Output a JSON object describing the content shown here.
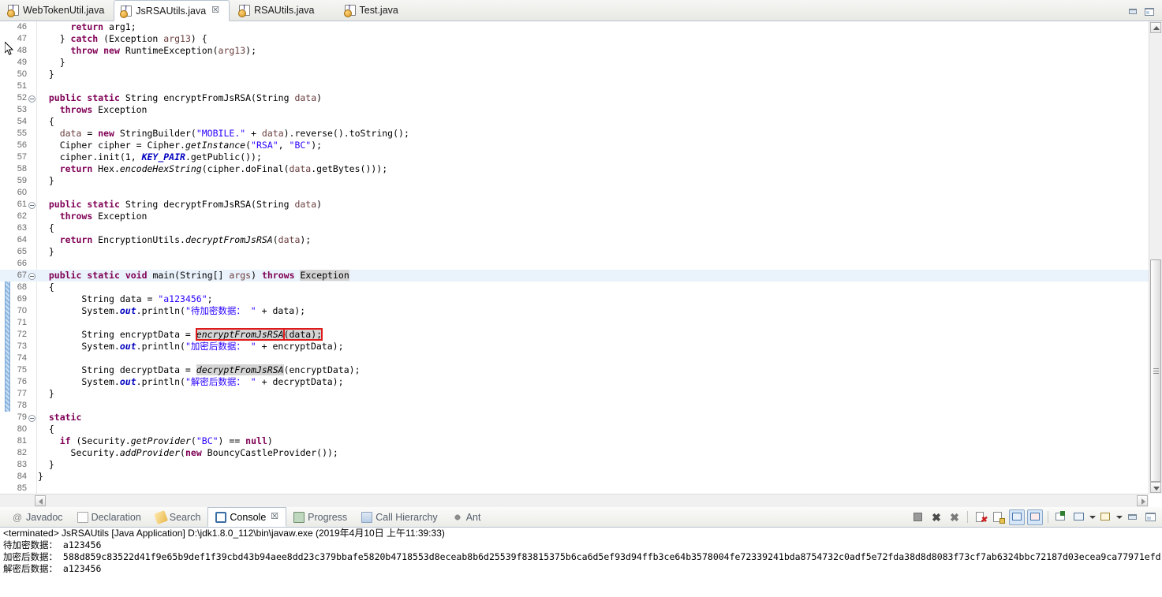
{
  "window": {
    "minimize_label": "Minimize",
    "maximize_label": "Maximize"
  },
  "editor_tabs": [
    {
      "label": "WebTokenUtil.java",
      "active": false,
      "closable": false
    },
    {
      "label": "JsRSAUtils.java",
      "active": true,
      "closable": true,
      "close_glyph": "☒"
    },
    {
      "label": "RSAUtils.java",
      "active": false,
      "closable": false
    },
    {
      "label": "Test.java",
      "active": false,
      "closable": false
    }
  ],
  "code": {
    "first_visible_line": 46,
    "highlighted_line": 67,
    "lines": [
      {
        "n": 46,
        "fold": false,
        "segments": [
          {
            "t": "      ",
            "c": ""
          },
          {
            "t": "return",
            "c": "kw"
          },
          {
            "t": " arg1;",
            "c": ""
          }
        ]
      },
      {
        "n": 47,
        "fold": false,
        "segments": [
          {
            "t": "    } ",
            "c": ""
          },
          {
            "t": "catch",
            "c": "kw"
          },
          {
            "t": " (Exception ",
            "c": ""
          },
          {
            "t": "arg13",
            "c": "par"
          },
          {
            "t": ") {",
            "c": ""
          }
        ]
      },
      {
        "n": 48,
        "fold": false,
        "segments": [
          {
            "t": "      ",
            "c": ""
          },
          {
            "t": "throw",
            "c": "kw"
          },
          {
            "t": " ",
            "c": ""
          },
          {
            "t": "new",
            "c": "kw"
          },
          {
            "t": " RuntimeException(",
            "c": ""
          },
          {
            "t": "arg13",
            "c": "par"
          },
          {
            "t": ");",
            "c": ""
          }
        ]
      },
      {
        "n": 49,
        "fold": false,
        "segments": [
          {
            "t": "    }",
            "c": ""
          }
        ]
      },
      {
        "n": 50,
        "fold": false,
        "segments": [
          {
            "t": "  }",
            "c": ""
          }
        ]
      },
      {
        "n": 51,
        "fold": false,
        "segments": [
          {
            "t": "",
            "c": ""
          }
        ]
      },
      {
        "n": 52,
        "fold": true,
        "segments": [
          {
            "t": "  ",
            "c": ""
          },
          {
            "t": "public",
            "c": "kw"
          },
          {
            "t": " ",
            "c": ""
          },
          {
            "t": "static",
            "c": "kw"
          },
          {
            "t": " String encryptFromJsRSA(String ",
            "c": ""
          },
          {
            "t": "data",
            "c": "par"
          },
          {
            "t": ")",
            "c": ""
          }
        ]
      },
      {
        "n": 53,
        "fold": false,
        "segments": [
          {
            "t": "    ",
            "c": ""
          },
          {
            "t": "throws",
            "c": "kw"
          },
          {
            "t": " Exception",
            "c": ""
          }
        ]
      },
      {
        "n": 54,
        "fold": false,
        "segments": [
          {
            "t": "  {",
            "c": ""
          }
        ]
      },
      {
        "n": 55,
        "fold": false,
        "segments": [
          {
            "t": "    ",
            "c": ""
          },
          {
            "t": "data",
            "c": "par"
          },
          {
            "t": " = ",
            "c": ""
          },
          {
            "t": "new",
            "c": "kw"
          },
          {
            "t": " StringBuilder(",
            "c": ""
          },
          {
            "t": "\"MOBILE.\"",
            "c": "str"
          },
          {
            "t": " + ",
            "c": ""
          },
          {
            "t": "data",
            "c": "par"
          },
          {
            "t": ").reverse().toString();",
            "c": ""
          }
        ]
      },
      {
        "n": 56,
        "fold": false,
        "segments": [
          {
            "t": "    Cipher cipher = Cipher.",
            "c": ""
          },
          {
            "t": "getInstance",
            "c": "mth"
          },
          {
            "t": "(",
            "c": ""
          },
          {
            "t": "\"RSA\"",
            "c": "str"
          },
          {
            "t": ", ",
            "c": ""
          },
          {
            "t": "\"BC\"",
            "c": "str"
          },
          {
            "t": ");",
            "c": ""
          }
        ]
      },
      {
        "n": 57,
        "fold": false,
        "segments": [
          {
            "t": "    cipher.init(1, ",
            "c": ""
          },
          {
            "t": "KEY_PAIR",
            "c": "fld"
          },
          {
            "t": ".getPublic());",
            "c": ""
          }
        ]
      },
      {
        "n": 58,
        "fold": false,
        "segments": [
          {
            "t": "    ",
            "c": ""
          },
          {
            "t": "return",
            "c": "kw"
          },
          {
            "t": " Hex.",
            "c": ""
          },
          {
            "t": "encodeHexString",
            "c": "mth"
          },
          {
            "t": "(cipher.doFinal(",
            "c": ""
          },
          {
            "t": "data",
            "c": "par"
          },
          {
            "t": ".getBytes()));",
            "c": ""
          }
        ]
      },
      {
        "n": 59,
        "fold": false,
        "segments": [
          {
            "t": "  }",
            "c": ""
          }
        ]
      },
      {
        "n": 60,
        "fold": false,
        "segments": [
          {
            "t": "",
            "c": ""
          }
        ]
      },
      {
        "n": 61,
        "fold": true,
        "segments": [
          {
            "t": "  ",
            "c": ""
          },
          {
            "t": "public",
            "c": "kw"
          },
          {
            "t": " ",
            "c": ""
          },
          {
            "t": "static",
            "c": "kw"
          },
          {
            "t": " String decryptFromJsRSA(String ",
            "c": ""
          },
          {
            "t": "data",
            "c": "par"
          },
          {
            "t": ")",
            "c": ""
          }
        ]
      },
      {
        "n": 62,
        "fold": false,
        "segments": [
          {
            "t": "    ",
            "c": ""
          },
          {
            "t": "throws",
            "c": "kw"
          },
          {
            "t": " Exception",
            "c": ""
          }
        ]
      },
      {
        "n": 63,
        "fold": false,
        "segments": [
          {
            "t": "  {",
            "c": ""
          }
        ]
      },
      {
        "n": 64,
        "fold": false,
        "segments": [
          {
            "t": "    ",
            "c": ""
          },
          {
            "t": "return",
            "c": "kw"
          },
          {
            "t": " EncryptionUtils.",
            "c": ""
          },
          {
            "t": "decryptFromJsRSA",
            "c": "mth"
          },
          {
            "t": "(",
            "c": ""
          },
          {
            "t": "data",
            "c": "par"
          },
          {
            "t": ");",
            "c": ""
          }
        ]
      },
      {
        "n": 65,
        "fold": false,
        "segments": [
          {
            "t": "  }",
            "c": ""
          }
        ]
      },
      {
        "n": 66,
        "fold": false,
        "segments": [
          {
            "t": "",
            "c": ""
          }
        ]
      },
      {
        "n": 67,
        "fold": true,
        "segments": [
          {
            "t": "  ",
            "c": ""
          },
          {
            "t": "public",
            "c": "kw"
          },
          {
            "t": " ",
            "c": ""
          },
          {
            "t": "static",
            "c": "kw"
          },
          {
            "t": " ",
            "c": ""
          },
          {
            "t": "void",
            "c": "kw"
          },
          {
            "t": " main(String[] ",
            "c": ""
          },
          {
            "t": "args",
            "c": "par"
          },
          {
            "t": ") ",
            "c": ""
          },
          {
            "t": "throws",
            "c": "kw"
          },
          {
            "t": " ",
            "c": ""
          },
          {
            "t": "Exception",
            "c": "occ"
          }
        ]
      },
      {
        "n": 68,
        "fold": false,
        "segments": [
          {
            "t": "  {",
            "c": ""
          }
        ]
      },
      {
        "n": 69,
        "fold": false,
        "segments": [
          {
            "t": "        String data = ",
            "c": ""
          },
          {
            "t": "\"a123456\"",
            "c": "str"
          },
          {
            "t": ";",
            "c": ""
          }
        ]
      },
      {
        "n": 70,
        "fold": false,
        "segments": [
          {
            "t": "        System.",
            "c": ""
          },
          {
            "t": "out",
            "c": "fld"
          },
          {
            "t": ".println(",
            "c": ""
          },
          {
            "t": "\"待加密数据： \"",
            "c": "str"
          },
          {
            "t": " + data);",
            "c": ""
          }
        ]
      },
      {
        "n": 71,
        "fold": false,
        "segments": [
          {
            "t": "",
            "c": ""
          }
        ]
      },
      {
        "n": 72,
        "fold": false,
        "segments": [
          {
            "t": "        String encryptData = ",
            "c": ""
          },
          {
            "t": "encryptFromJsRSA",
            "c": "boxedmth"
          },
          {
            "t": "(data);",
            "c": "boxedplain"
          }
        ]
      },
      {
        "n": 73,
        "fold": false,
        "segments": [
          {
            "t": "        System.",
            "c": ""
          },
          {
            "t": "out",
            "c": "fld"
          },
          {
            "t": ".println(",
            "c": ""
          },
          {
            "t": "\"加密后数据： \"",
            "c": "str"
          },
          {
            "t": " + encryptData);",
            "c": ""
          }
        ]
      },
      {
        "n": 74,
        "fold": false,
        "segments": [
          {
            "t": "",
            "c": ""
          }
        ]
      },
      {
        "n": 75,
        "fold": false,
        "segments": [
          {
            "t": "        String decryptData = ",
            "c": ""
          },
          {
            "t": "decryptFromJsRSA",
            "c": "occmth"
          },
          {
            "t": "(encryptData);",
            "c": ""
          }
        ]
      },
      {
        "n": 76,
        "fold": false,
        "segments": [
          {
            "t": "        System.",
            "c": ""
          },
          {
            "t": "out",
            "c": "fld"
          },
          {
            "t": ".println(",
            "c": ""
          },
          {
            "t": "\"解密后数据： \"",
            "c": "str"
          },
          {
            "t": " + decryptData);",
            "c": ""
          }
        ]
      },
      {
        "n": 77,
        "fold": false,
        "segments": [
          {
            "t": "  }",
            "c": ""
          }
        ]
      },
      {
        "n": 78,
        "fold": false,
        "segments": [
          {
            "t": "",
            "c": ""
          }
        ]
      },
      {
        "n": 79,
        "fold": true,
        "segments": [
          {
            "t": "  ",
            "c": ""
          },
          {
            "t": "static",
            "c": "kw"
          }
        ]
      },
      {
        "n": 80,
        "fold": false,
        "segments": [
          {
            "t": "  {",
            "c": ""
          }
        ]
      },
      {
        "n": 81,
        "fold": false,
        "segments": [
          {
            "t": "    ",
            "c": ""
          },
          {
            "t": "if",
            "c": "kw"
          },
          {
            "t": " (Security.",
            "c": ""
          },
          {
            "t": "getProvider",
            "c": "mth"
          },
          {
            "t": "(",
            "c": ""
          },
          {
            "t": "\"BC\"",
            "c": "str"
          },
          {
            "t": ") == ",
            "c": ""
          },
          {
            "t": "null",
            "c": "kw"
          },
          {
            "t": ")",
            "c": ""
          }
        ]
      },
      {
        "n": 82,
        "fold": false,
        "segments": [
          {
            "t": "      Security.",
            "c": ""
          },
          {
            "t": "addProvider",
            "c": "mth"
          },
          {
            "t": "(",
            "c": ""
          },
          {
            "t": "new",
            "c": "kw"
          },
          {
            "t": " BouncyCastleProvider());",
            "c": ""
          }
        ]
      },
      {
        "n": 83,
        "fold": false,
        "segments": [
          {
            "t": "  }",
            "c": ""
          }
        ]
      },
      {
        "n": 84,
        "fold": false,
        "segments": [
          {
            "t": "}",
            "c": ""
          }
        ]
      },
      {
        "n": 85,
        "fold": false,
        "segments": [
          {
            "t": "",
            "c": ""
          }
        ]
      }
    ]
  },
  "view_tabs": [
    {
      "label": "Javadoc",
      "icon": "javadoc-icon",
      "active": false
    },
    {
      "label": "Declaration",
      "icon": "declaration-icon",
      "active": false
    },
    {
      "label": "Search",
      "icon": "search-icon",
      "active": false
    },
    {
      "label": "Console",
      "icon": "console-icon",
      "active": true,
      "close_glyph": "☒"
    },
    {
      "label": "Progress",
      "icon": "progress-icon",
      "active": false
    },
    {
      "label": "Call Hierarchy",
      "icon": "call-hierarchy-icon",
      "active": false
    },
    {
      "label": "Ant",
      "icon": "ant-icon",
      "active": false
    }
  ],
  "console_toolbar": [
    {
      "name": "terminate-button",
      "pressed": false
    },
    {
      "name": "remove-launch-button",
      "pressed": false
    },
    {
      "name": "remove-all-terminated-button",
      "pressed": false
    },
    {
      "name": "separator",
      "pressed": false
    },
    {
      "name": "clear-console-button",
      "pressed": false
    },
    {
      "name": "scroll-lock-button",
      "pressed": false
    },
    {
      "name": "show-console-on-output-button",
      "pressed": true
    },
    {
      "name": "show-console-on-error-button",
      "pressed": true
    },
    {
      "name": "separator",
      "pressed": false
    },
    {
      "name": "pin-console-button",
      "pressed": false
    },
    {
      "name": "display-selected-console-button",
      "pressed": false
    },
    {
      "name": "display-selected-console-dropdown",
      "pressed": false
    },
    {
      "name": "open-console-button",
      "pressed": false
    },
    {
      "name": "open-console-dropdown",
      "pressed": false
    },
    {
      "name": "minimize-view-button",
      "pressed": false
    },
    {
      "name": "maximize-view-button",
      "pressed": false
    }
  ],
  "console": {
    "header": "<terminated> JsRSAUtils [Java Application] D:\\jdk1.8.0_112\\bin\\javaw.exe (2019年4月10日 上午11:39:33)",
    "lines": [
      "待加密数据： a123456",
      "加密后数据： 588d859c83522d41f9e65b9def1f39cbd43b94aee8dd23c379bbafe5820b4718553d8eceab8b6d25539f83815375b6ca6d5ef93d94ffb3ce64b3578004fe72339241bda8754732c0adf5e72fda38d8d8083f73cf7ab6324bbc72187d03ecea9ca77971efd",
      "解密后数据： a123456"
    ]
  },
  "colors": {
    "keyword": "#7F0055",
    "string": "#2A00FF",
    "field": "#0000C0",
    "parameter": "#6A3E3E",
    "occurrence_highlight": "#D4D4D4",
    "error_box": "#E01B1B",
    "selected_line": "#EAF2FB",
    "change_bar": "#8FB8E0"
  }
}
